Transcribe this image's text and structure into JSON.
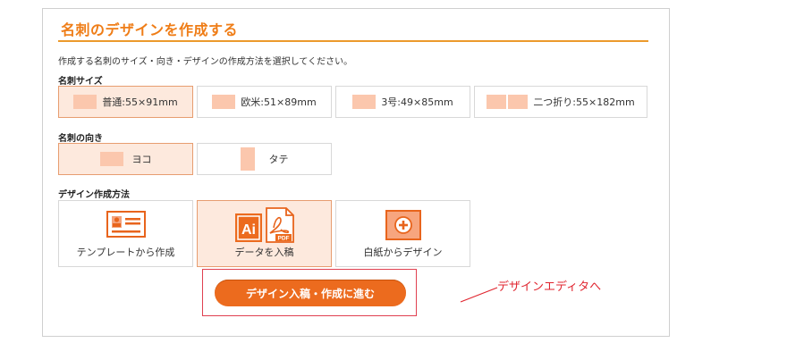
{
  "panel": {
    "title": "名刺のデザインを作成する",
    "description": "作成する名刺のサイズ・向き・デザインの作成方法を選択してください。"
  },
  "size_section": {
    "label": "名刺サイズ",
    "options": [
      {
        "label": "普通:55×91mm",
        "selected": true
      },
      {
        "label": "欧米:51×89mm",
        "selected": false
      },
      {
        "label": "3号:49×85mm",
        "selected": false
      },
      {
        "label": "二つ折り:55×182mm",
        "selected": false
      }
    ]
  },
  "orientation_section": {
    "label": "名刺の向き",
    "options": [
      {
        "label": "ヨコ",
        "selected": true
      },
      {
        "label": "タテ",
        "selected": false
      }
    ]
  },
  "method_section": {
    "label": "デザイン作成方法",
    "options": [
      {
        "label": "テンプレートから作成",
        "icon": "business-card-template-icon",
        "selected": false
      },
      {
        "label": "データを入稿",
        "icon": "ai-pdf-file-icon",
        "selected": true
      },
      {
        "label": "白紙からデザイン",
        "icon": "plus-blank-icon",
        "selected": false
      }
    ]
  },
  "cta": {
    "label": "デザイン入稿・作成に進む"
  },
  "annotation": {
    "text": "デザインエディタへ"
  },
  "colors": {
    "accent": "#ef7d17",
    "selected_bg": "#fde9dd",
    "swatch": "#fbc7ad",
    "cta": "#ec6b1e",
    "annotation": "#e0252f"
  }
}
